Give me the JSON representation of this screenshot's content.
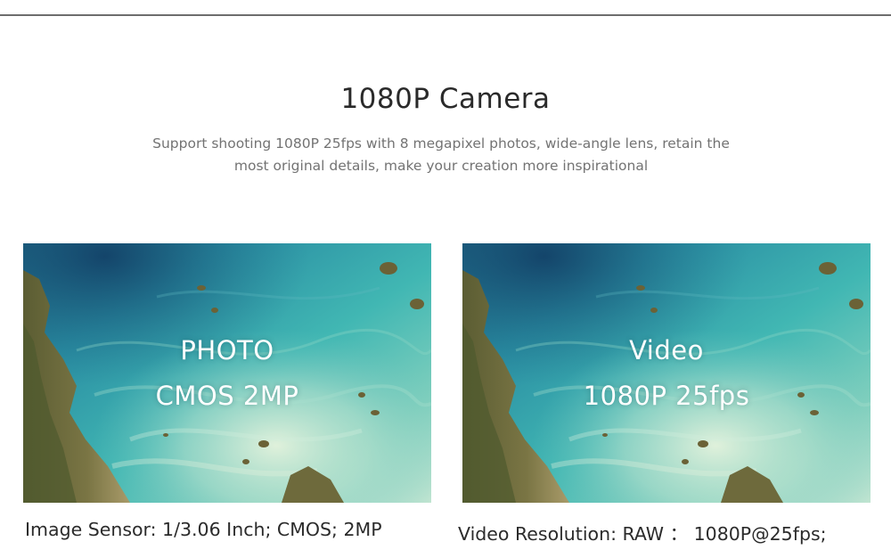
{
  "section": {
    "title": "1080P Camera",
    "subtitle": "Support shooting 1080P 25fps with 8 megapixel photos, wide-angle lens, retain the most original details, make your creation more inspirational"
  },
  "cards": [
    {
      "line1": "PHOTO",
      "line2": "CMOS 2MP",
      "caption": "Image Sensor: 1/3.06 Inch; CMOS; 2MP"
    },
    {
      "line1": "Video",
      "line2": "1080P 25fps",
      "caption": "Video Resolution: RAW ： 1080P@25fps;"
    }
  ],
  "colors": {
    "ocean_deep": "#1f6f8a",
    "ocean_turquoise": "#3fb3b4",
    "ocean_pale": "#bfe3d0",
    "land": "#6b6a3a",
    "rule": "#6d6d6d",
    "title": "#2a2a2a",
    "subtitle": "#737373"
  }
}
